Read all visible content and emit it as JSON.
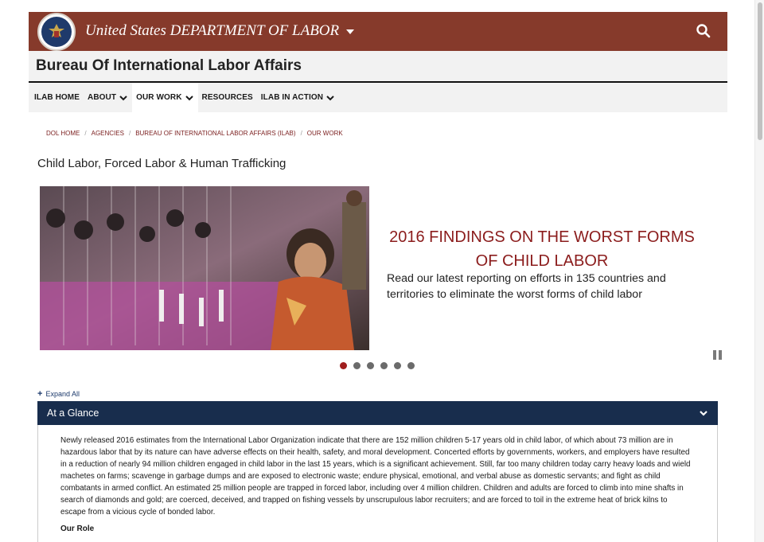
{
  "header": {
    "agency_title": "United States DEPARTMENT OF LABOR",
    "seal_icon": "dol-seal-logo",
    "search_icon": "search-icon"
  },
  "bureau": {
    "title": "Bureau Of International Labor Affairs"
  },
  "nav": {
    "items": [
      {
        "label": "ILAB HOME",
        "has_dropdown": false
      },
      {
        "label": "ABOUT",
        "has_dropdown": true
      },
      {
        "label": "OUR WORK",
        "has_dropdown": true,
        "active": true
      },
      {
        "label": "RESOURCES",
        "has_dropdown": false
      },
      {
        "label": "ILAB IN ACTION",
        "has_dropdown": true
      }
    ]
  },
  "breadcrumb": [
    "DOL HOME",
    "AGENCIES",
    "BUREAU OF INTERNATIONAL LABOR AFFAIRS (ILAB)",
    "OUR WORK"
  ],
  "page_title": "Child Labor, Forced Labor & Human Trafficking",
  "carousel": {
    "heading": "2016 FINDINGS ON THE WORST FORMS OF CHILD LABOR",
    "text": "Read our latest reporting on efforts in 135 countries and territories to eliminate the worst forms of child labor",
    "slide_count": 6,
    "active_index": 0
  },
  "accordion": {
    "expand_all_label": "Expand All",
    "section_title": "At a Glance",
    "paragraph": "Newly released 2016 estimates from the International Labor Organization indicate that there are 152 million children 5-17 years old in child labor, of which about 73 million are in hazardous labor that by its nature can have adverse effects on their health, safety, and moral development. Concerted efforts by governments, workers, and employers have resulted in a reduction of nearly 94 million children engaged in child labor in the last 15 years, which is a significant achievement. Still, far too many children today carry heavy loads and wield machetes on farms; scavenge in garbage dumps and are exposed to electronic waste; endure physical, emotional, and verbal abuse as domestic servants; and fight as child combatants in armed conflict. An estimated 25 million people are trapped in forced labor, including over 4 million children. Children and adults are forced to climb into mine shafts in search of diamonds and gold; are coerced, deceived, and trapped on fishing vessels by unscrupulous labor recruiters; and are forced to toil in the extreme heat of brick kilns to escape from a vicious cycle of bonded labor.",
    "subheading": "Our Role"
  },
  "colors": {
    "brand": "#863a2b",
    "accent_red": "#8b1c1c",
    "navy": "#182d4d"
  }
}
